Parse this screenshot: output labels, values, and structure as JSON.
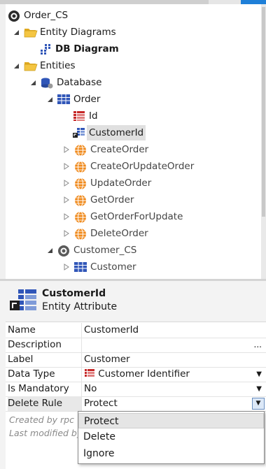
{
  "tree": {
    "root": "Order_CS",
    "entity_diagrams": "Entity Diagrams",
    "db_diagram": "DB Diagram",
    "entities": "Entities",
    "database": "Database",
    "order": "Order",
    "attributes": [
      "Id",
      "CustomerId"
    ],
    "actions": [
      "CreateOrder",
      "CreateOrUpdateOrder",
      "UpdateOrder",
      "GetOrder",
      "GetOrderForUpdate",
      "DeleteOrder"
    ],
    "customer_cs": "Customer_CS",
    "customer": "Customer"
  },
  "header": {
    "title": "CustomerId",
    "subtitle": "Entity Attribute"
  },
  "properties": {
    "name_label": "Name",
    "name_value": "CustomerId",
    "description_label": "Description",
    "description_value": "",
    "label_label": "Label",
    "label_value": "Customer",
    "datatype_label": "Data Type",
    "datatype_value": "Customer Identifier",
    "mandatory_label": "Is Mandatory",
    "mandatory_value": "No",
    "deleterule_label": "Delete Rule",
    "deleterule_value": "Protect",
    "ellipsis": "..."
  },
  "footer": {
    "created": "Created by rpc",
    "modified": "Last modified by"
  },
  "dropdown_options": [
    "Protect",
    "Delete",
    "Ignore"
  ],
  "colors": {
    "accent": "#1e7fd8",
    "orange": "#f08a1c",
    "folder": "#f4c542",
    "blue_icon": "#3056b8",
    "red_icon": "#c62828"
  }
}
